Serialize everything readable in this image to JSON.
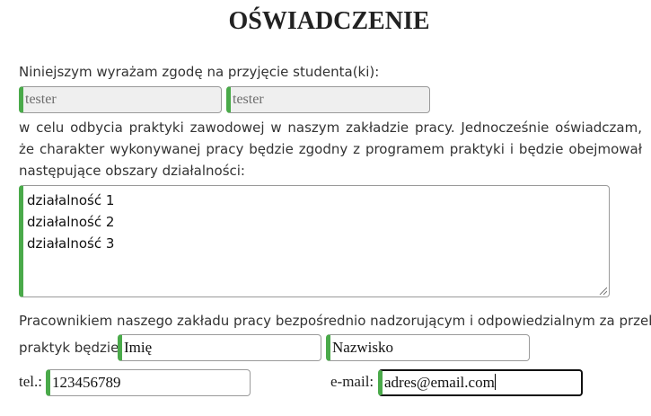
{
  "title": "OŚWIADCZENIE",
  "intro": "Niniejszym wyrażam zgodę na przyjęcie studenta(ki):",
  "student": {
    "first_name": "tester",
    "last_name": "tester"
  },
  "purpose_text": "w celu odbycia praktyki zawodowej w naszym zakładzie pracy. Jednocześnie oświadczam, że charakter wykonywanej pracy będzie zgodny z programem praktyki i będzie obejmował następujące obszary działalności:",
  "activities": [
    "działalność 1",
    "działalność 2",
    "działalność 3"
  ],
  "supervisor_text": "Pracownikiem naszego zakładu pracy bezpośrednio nadzorującym i odpowiedzialnym za przebieg",
  "supervisor_label": "praktyk będzie:",
  "supervisor": {
    "first_name": "Imię",
    "last_name": "Nazwisko"
  },
  "phone": {
    "label": "tel.:",
    "value": "123456789"
  },
  "email": {
    "label": "e-mail:",
    "value": "adres@email.com"
  },
  "colors": {
    "accent": "#4aaa4a",
    "disabled_bg": "#efefef"
  }
}
